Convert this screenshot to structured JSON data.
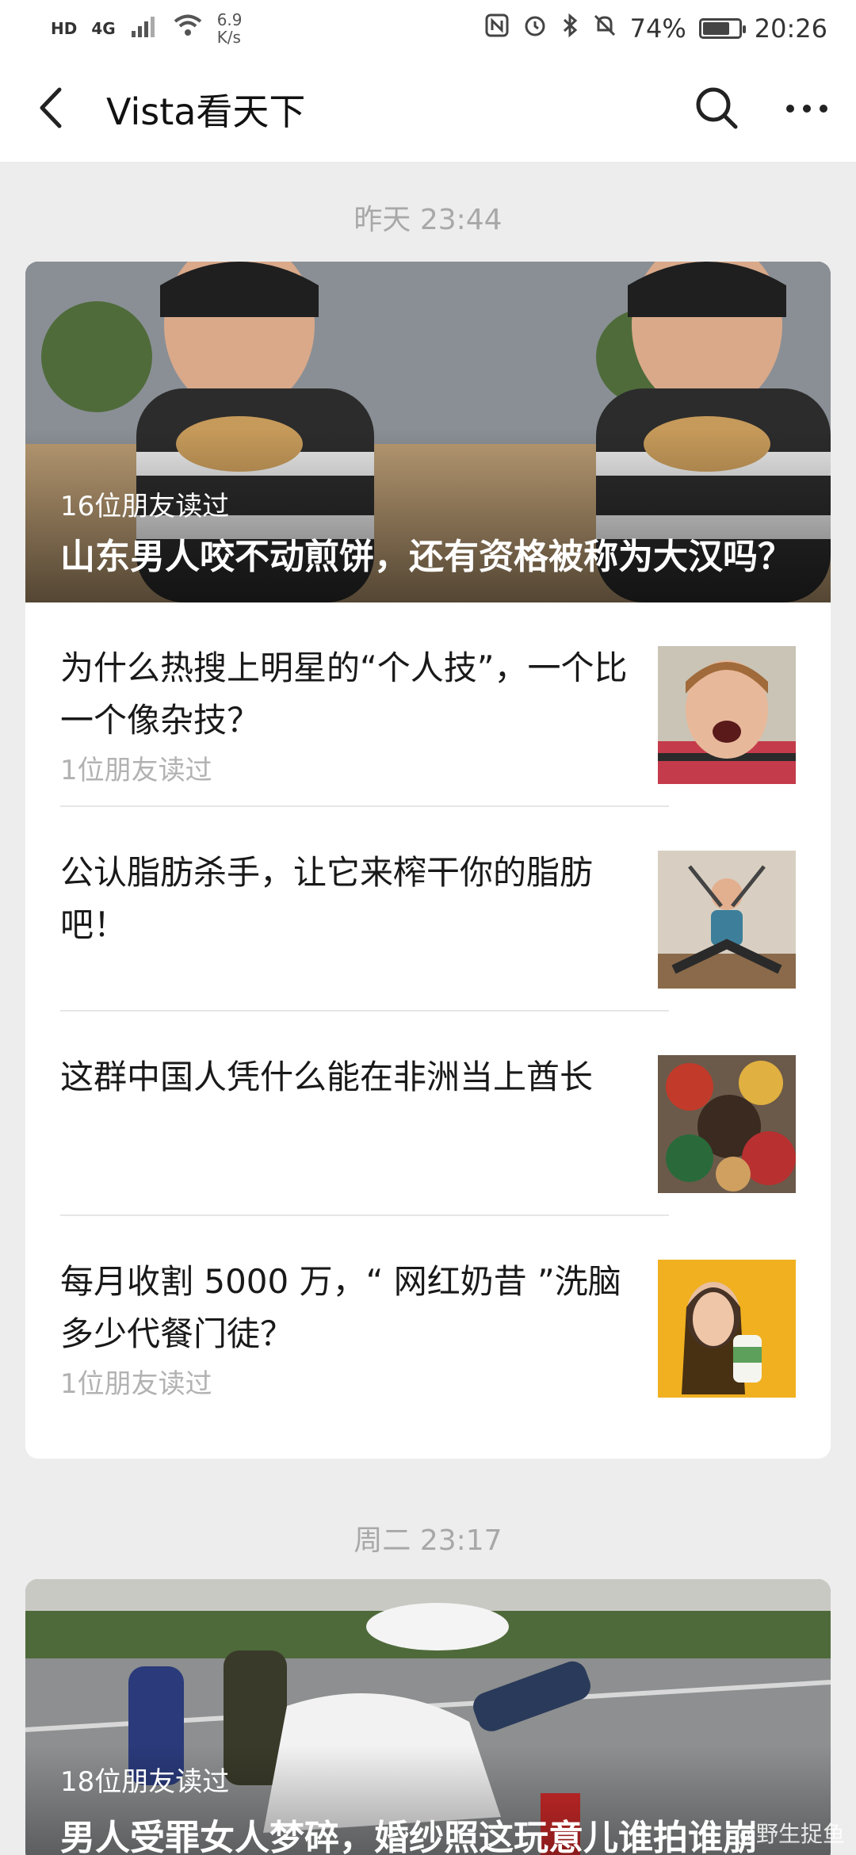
{
  "status_bar": {
    "hd_badge": "HD",
    "network_badge": "4G",
    "net_speed_value": "6.9",
    "net_speed_unit": "K/s",
    "battery_percent": "74%",
    "battery_level": 0.74,
    "time": "20:26"
  },
  "header": {
    "title": "Vista看天下",
    "back_icon": "chevron-left-icon",
    "search_icon": "search-icon",
    "more_icon": "more-icon"
  },
  "feed": [
    {
      "timestamp": "昨天 23:44",
      "hero": {
        "readers": "16位朋友读过",
        "title": "山东男人咬不动煎饼，还有资格被称为大汉吗？"
      },
      "articles": [
        {
          "title": "为什么热搜上明星的“个人技”，一个比一个像杂技？",
          "readers": "1位朋友读过"
        },
        {
          "title": "公认脂肪杀手，让它来榨干你的脂肪吧！",
          "readers": ""
        },
        {
          "title": "这群中国人凭什么能在非洲当上酋长",
          "readers": ""
        },
        {
          "title": "每月收割 5000 万，“ 网红奶昔 ”洗脑多少代餐门徒？",
          "readers": "1位朋友读过"
        }
      ]
    },
    {
      "timestamp": "周二 23:17",
      "hero": {
        "readers": "18位朋友读过",
        "title": "男人受罪女人梦碎，婚纱照这玩意儿谁拍谁崩"
      }
    }
  ],
  "watermark": "@野生捉鱼"
}
